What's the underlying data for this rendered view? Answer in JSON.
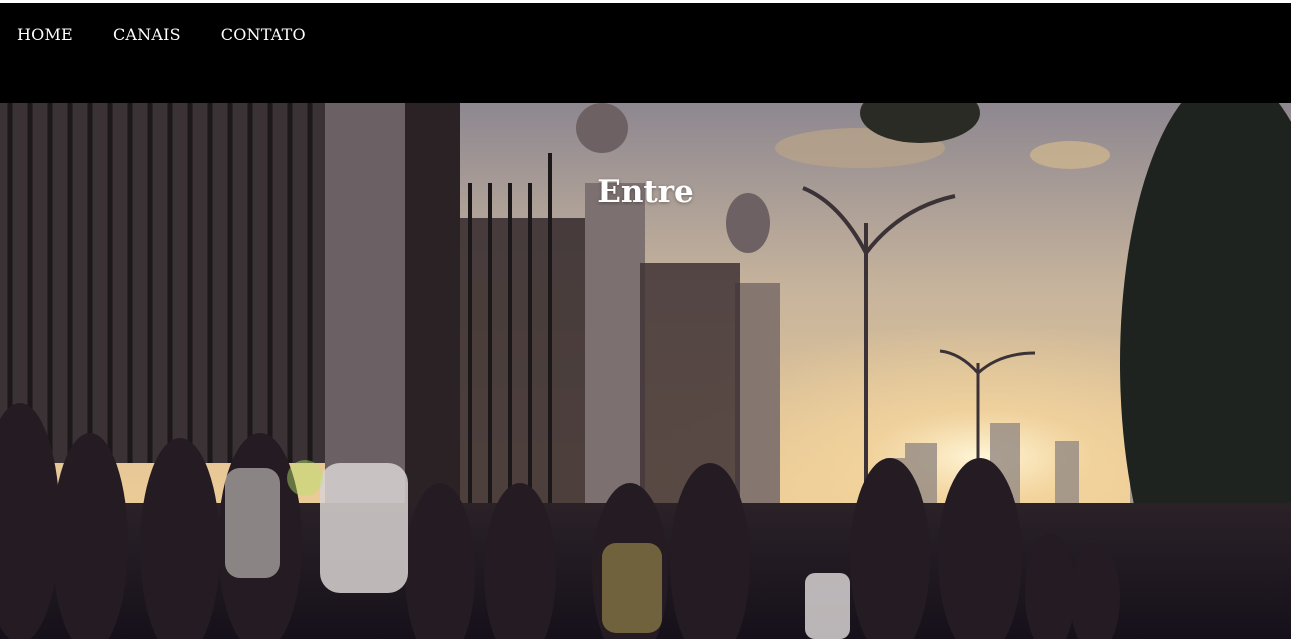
{
  "nav": {
    "items": [
      {
        "label": "HOME"
      },
      {
        "label": "CANAIS"
      },
      {
        "label": "CONTATO"
      }
    ]
  },
  "hero": {
    "title": "Entre",
    "image": "sunset-city-gate-crowd-photo"
  },
  "colors": {
    "topbar": "#000000",
    "nav_text": "#ffffff",
    "hero_title": "#ffffff"
  }
}
